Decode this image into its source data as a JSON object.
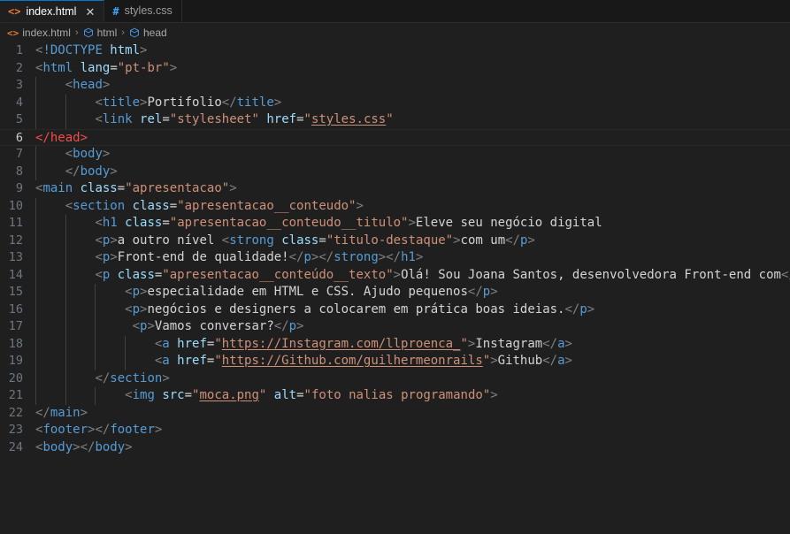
{
  "window": {
    "editor_background": "#1f1f1f",
    "tabbar_background": "#181818",
    "accent": "#0078d4"
  },
  "tabs": [
    {
      "label": "index.html",
      "icon": "html-file-icon",
      "icon_glyph": "<>",
      "icon_color": "#e37933",
      "active": true,
      "close_glyph": "✕"
    },
    {
      "label": "styles.css",
      "icon": "css-file-icon",
      "icon_glyph": "#",
      "icon_color": "#42a5f5",
      "active": false
    }
  ],
  "breadcrumb": {
    "items": [
      {
        "label": "index.html",
        "icon": "html-file-icon"
      },
      {
        "label": "html",
        "icon": "symbol-cube-icon"
      },
      {
        "label": "head",
        "icon": "symbol-cube-icon"
      }
    ],
    "separator": "›"
  },
  "editor": {
    "language": "html",
    "active_line": 6,
    "lines": [
      {
        "n": 1,
        "guides": 0,
        "tokens": [
          {
            "c": "punct",
            "t": "<"
          },
          {
            "c": "tag",
            "t": "!DOCTYPE "
          },
          {
            "c": "attr",
            "t": "html"
          },
          {
            "c": "punct",
            "t": ">"
          }
        ]
      },
      {
        "n": 2,
        "guides": 0,
        "tokens": [
          {
            "c": "punct",
            "t": "<"
          },
          {
            "c": "tag",
            "t": "html "
          },
          {
            "c": "attr",
            "t": "lang"
          },
          {
            "c": "eq",
            "t": "="
          },
          {
            "c": "str",
            "t": "\"pt-br\""
          },
          {
            "c": "punct",
            "t": ">"
          }
        ]
      },
      {
        "n": 3,
        "guides": 1,
        "tokens": [
          {
            "c": "text",
            "t": "    "
          },
          {
            "c": "punct",
            "t": "<"
          },
          {
            "c": "tag",
            "t": "head"
          },
          {
            "c": "punct",
            "t": ">"
          }
        ]
      },
      {
        "n": 4,
        "guides": 2,
        "tokens": [
          {
            "c": "text",
            "t": "        "
          },
          {
            "c": "punct",
            "t": "<"
          },
          {
            "c": "tag",
            "t": "title"
          },
          {
            "c": "punct",
            "t": ">"
          },
          {
            "c": "text",
            "t": "Portifolio"
          },
          {
            "c": "punct",
            "t": "</"
          },
          {
            "c": "tag",
            "t": "title"
          },
          {
            "c": "punct",
            "t": ">"
          }
        ]
      },
      {
        "n": 5,
        "guides": 2,
        "tokens": [
          {
            "c": "text",
            "t": "        "
          },
          {
            "c": "punct",
            "t": "<"
          },
          {
            "c": "tag",
            "t": "link "
          },
          {
            "c": "attr",
            "t": "rel"
          },
          {
            "c": "eq",
            "t": "="
          },
          {
            "c": "str",
            "t": "\"stylesheet\""
          },
          {
            "c": "text",
            "t": " "
          },
          {
            "c": "attr",
            "t": "href"
          },
          {
            "c": "eq",
            "t": "="
          },
          {
            "c": "str",
            "t": "\""
          },
          {
            "c": "link",
            "t": "styles.css"
          },
          {
            "c": "str",
            "t": "\""
          }
        ]
      },
      {
        "n": 6,
        "guides": 0,
        "current": true,
        "tokens": [
          {
            "c": "err",
            "t": "</head>"
          }
        ]
      },
      {
        "n": 7,
        "guides": 1,
        "tokens": [
          {
            "c": "text",
            "t": "    "
          },
          {
            "c": "punct",
            "t": "<"
          },
          {
            "c": "tag",
            "t": "body"
          },
          {
            "c": "punct",
            "t": ">"
          }
        ]
      },
      {
        "n": 8,
        "guides": 1,
        "tokens": [
          {
            "c": "text",
            "t": "    "
          },
          {
            "c": "punct",
            "t": "</"
          },
          {
            "c": "tag",
            "t": "body"
          },
          {
            "c": "punct",
            "t": ">"
          }
        ]
      },
      {
        "n": 9,
        "guides": 0,
        "tokens": [
          {
            "c": "punct",
            "t": "<"
          },
          {
            "c": "tag",
            "t": "main "
          },
          {
            "c": "attr",
            "t": "class"
          },
          {
            "c": "eq",
            "t": "="
          },
          {
            "c": "str",
            "t": "\"apresentacao\""
          },
          {
            "c": "punct",
            "t": ">"
          }
        ]
      },
      {
        "n": 10,
        "guides": 1,
        "tokens": [
          {
            "c": "text",
            "t": "    "
          },
          {
            "c": "punct",
            "t": "<"
          },
          {
            "c": "tag",
            "t": "section "
          },
          {
            "c": "attr",
            "t": "class"
          },
          {
            "c": "eq",
            "t": "="
          },
          {
            "c": "str",
            "t": "\"apresentacao__conteudo\""
          },
          {
            "c": "punct",
            "t": ">"
          }
        ]
      },
      {
        "n": 11,
        "guides": 2,
        "tokens": [
          {
            "c": "text",
            "t": "        "
          },
          {
            "c": "punct",
            "t": "<"
          },
          {
            "c": "tag",
            "t": "h1 "
          },
          {
            "c": "attr",
            "t": "class"
          },
          {
            "c": "eq",
            "t": "="
          },
          {
            "c": "str",
            "t": "\"apresentacao__conteudo__titulo\""
          },
          {
            "c": "punct",
            "t": ">"
          },
          {
            "c": "text",
            "t": "Eleve seu negócio digital"
          }
        ]
      },
      {
        "n": 12,
        "guides": 2,
        "tokens": [
          {
            "c": "text",
            "t": "        "
          },
          {
            "c": "punct",
            "t": "<"
          },
          {
            "c": "tag",
            "t": "p"
          },
          {
            "c": "punct",
            "t": ">"
          },
          {
            "c": "text",
            "t": "a outro nível "
          },
          {
            "c": "punct",
            "t": "<"
          },
          {
            "c": "tag",
            "t": "strong "
          },
          {
            "c": "attr",
            "t": "class"
          },
          {
            "c": "eq",
            "t": "="
          },
          {
            "c": "str",
            "t": "\"titulo-destaque\""
          },
          {
            "c": "punct",
            "t": ">"
          },
          {
            "c": "text",
            "t": "com um"
          },
          {
            "c": "punct",
            "t": "</"
          },
          {
            "c": "tag",
            "t": "p"
          },
          {
            "c": "punct",
            "t": ">"
          }
        ]
      },
      {
        "n": 13,
        "guides": 2,
        "tokens": [
          {
            "c": "text",
            "t": "        "
          },
          {
            "c": "punct",
            "t": "<"
          },
          {
            "c": "tag",
            "t": "p"
          },
          {
            "c": "punct",
            "t": ">"
          },
          {
            "c": "text",
            "t": "Front-end de qualidade!"
          },
          {
            "c": "punct",
            "t": "</"
          },
          {
            "c": "tag",
            "t": "p"
          },
          {
            "c": "punct",
            "t": "></"
          },
          {
            "c": "tag",
            "t": "strong"
          },
          {
            "c": "punct",
            "t": "></"
          },
          {
            "c": "tag",
            "t": "h1"
          },
          {
            "c": "punct",
            "t": ">"
          }
        ]
      },
      {
        "n": 14,
        "guides": 2,
        "tokens": [
          {
            "c": "text",
            "t": "        "
          },
          {
            "c": "punct",
            "t": "<"
          },
          {
            "c": "tag",
            "t": "p "
          },
          {
            "c": "attr",
            "t": "class"
          },
          {
            "c": "eq",
            "t": "="
          },
          {
            "c": "str",
            "t": "\"apresentacao__conteúdo__texto\""
          },
          {
            "c": "punct",
            "t": ">"
          },
          {
            "c": "text",
            "t": "Olá! Sou Joana Santos, desenvolvedora Front-end com"
          },
          {
            "c": "punct",
            "t": "</"
          },
          {
            "c": "tag",
            "t": "p"
          },
          {
            "c": "punct",
            "t": ">"
          }
        ]
      },
      {
        "n": 15,
        "guides": 3,
        "tokens": [
          {
            "c": "text",
            "t": "            "
          },
          {
            "c": "punct",
            "t": "<"
          },
          {
            "c": "tag",
            "t": "p"
          },
          {
            "c": "punct",
            "t": ">"
          },
          {
            "c": "text",
            "t": "especialidade em HTML e CSS. Ajudo pequenos"
          },
          {
            "c": "punct",
            "t": "</"
          },
          {
            "c": "tag",
            "t": "p"
          },
          {
            "c": "punct",
            "t": ">"
          }
        ]
      },
      {
        "n": 16,
        "guides": 3,
        "tokens": [
          {
            "c": "text",
            "t": "            "
          },
          {
            "c": "punct",
            "t": "<"
          },
          {
            "c": "tag",
            "t": "p"
          },
          {
            "c": "punct",
            "t": ">"
          },
          {
            "c": "text",
            "t": "negócios e designers a colocarem em prática boas ideias."
          },
          {
            "c": "punct",
            "t": "</"
          },
          {
            "c": "tag",
            "t": "p"
          },
          {
            "c": "punct",
            "t": ">"
          }
        ]
      },
      {
        "n": 17,
        "guides": 3,
        "tokens": [
          {
            "c": "text",
            "t": "             "
          },
          {
            "c": "punct",
            "t": "<"
          },
          {
            "c": "tag",
            "t": "p"
          },
          {
            "c": "punct",
            "t": ">"
          },
          {
            "c": "text",
            "t": "Vamos conversar?"
          },
          {
            "c": "punct",
            "t": "</"
          },
          {
            "c": "tag",
            "t": "p"
          },
          {
            "c": "punct",
            "t": ">"
          }
        ]
      },
      {
        "n": 18,
        "guides": 4,
        "tokens": [
          {
            "c": "text",
            "t": "                "
          },
          {
            "c": "punct",
            "t": "<"
          },
          {
            "c": "tag",
            "t": "a "
          },
          {
            "c": "attr",
            "t": "href"
          },
          {
            "c": "eq",
            "t": "="
          },
          {
            "c": "str",
            "t": "\""
          },
          {
            "c": "link",
            "t": "https://Instagram.com/llproenca_"
          },
          {
            "c": "str",
            "t": "\""
          },
          {
            "c": "punct",
            "t": ">"
          },
          {
            "c": "text",
            "t": "Instagram"
          },
          {
            "c": "punct",
            "t": "</"
          },
          {
            "c": "tag",
            "t": "a"
          },
          {
            "c": "punct",
            "t": ">"
          }
        ]
      },
      {
        "n": 19,
        "guides": 4,
        "tokens": [
          {
            "c": "text",
            "t": "                "
          },
          {
            "c": "punct",
            "t": "<"
          },
          {
            "c": "tag",
            "t": "a "
          },
          {
            "c": "attr",
            "t": "href"
          },
          {
            "c": "eq",
            "t": "="
          },
          {
            "c": "str",
            "t": "\""
          },
          {
            "c": "link",
            "t": "https://Github.com/guilhermeonrails"
          },
          {
            "c": "str",
            "t": "\""
          },
          {
            "c": "punct",
            "t": ">"
          },
          {
            "c": "text",
            "t": "Github"
          },
          {
            "c": "punct",
            "t": "</"
          },
          {
            "c": "tag",
            "t": "a"
          },
          {
            "c": "punct",
            "t": ">"
          }
        ]
      },
      {
        "n": 20,
        "guides": 2,
        "tokens": [
          {
            "c": "text",
            "t": "        "
          },
          {
            "c": "punct",
            "t": "</"
          },
          {
            "c": "tag",
            "t": "section"
          },
          {
            "c": "punct",
            "t": ">"
          }
        ]
      },
      {
        "n": 21,
        "guides": 3,
        "tokens": [
          {
            "c": "text",
            "t": "            "
          },
          {
            "c": "punct",
            "t": "<"
          },
          {
            "c": "tag",
            "t": "img "
          },
          {
            "c": "attr",
            "t": "src"
          },
          {
            "c": "eq",
            "t": "="
          },
          {
            "c": "str",
            "t": "\""
          },
          {
            "c": "link",
            "t": "moca.png"
          },
          {
            "c": "str",
            "t": "\""
          },
          {
            "c": "text",
            "t": " "
          },
          {
            "c": "attr",
            "t": "alt"
          },
          {
            "c": "eq",
            "t": "="
          },
          {
            "c": "str",
            "t": "\"foto nalias programando\""
          },
          {
            "c": "punct",
            "t": ">"
          }
        ]
      },
      {
        "n": 22,
        "guides": 0,
        "tokens": [
          {
            "c": "punct",
            "t": "</"
          },
          {
            "c": "tag",
            "t": "main"
          },
          {
            "c": "punct",
            "t": ">"
          }
        ]
      },
      {
        "n": 23,
        "guides": 0,
        "tokens": [
          {
            "c": "punct",
            "t": "<"
          },
          {
            "c": "tag",
            "t": "footer"
          },
          {
            "c": "punct",
            "t": "></"
          },
          {
            "c": "tag",
            "t": "footer"
          },
          {
            "c": "punct",
            "t": ">"
          }
        ]
      },
      {
        "n": 24,
        "guides": 0,
        "tokens": [
          {
            "c": "punct",
            "t": "<"
          },
          {
            "c": "tag",
            "t": "body"
          },
          {
            "c": "punct",
            "t": "></"
          },
          {
            "c": "tag",
            "t": "body"
          },
          {
            "c": "punct",
            "t": ">"
          }
        ]
      }
    ]
  }
}
